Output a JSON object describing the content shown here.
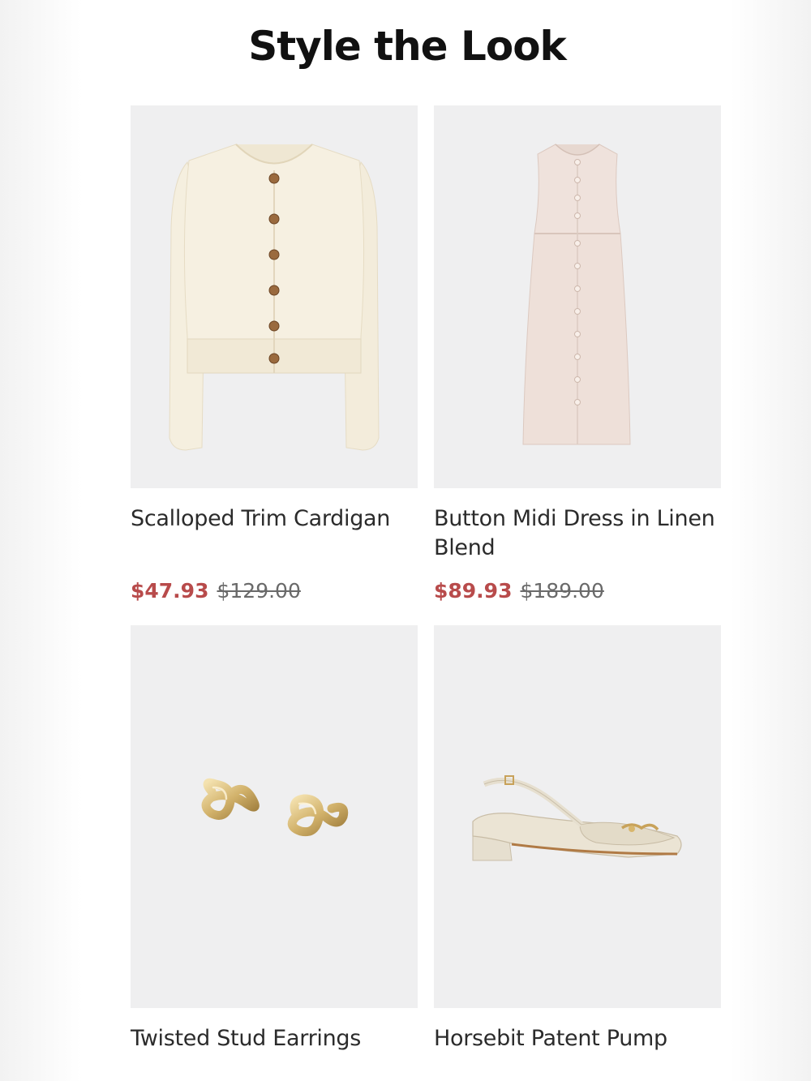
{
  "page": {
    "title": "Style the Look"
  },
  "products": [
    {
      "name": "Scalloped Trim Cardigan",
      "sale_price": "$47.93",
      "original_price": "$129.00",
      "image": "cardigan-image"
    },
    {
      "name": "Button Midi Dress in Linen Blend",
      "sale_price": "$89.93",
      "original_price": "$189.00",
      "image": "dress-image"
    },
    {
      "name": "Twisted Stud Earrings",
      "image": "earrings-image"
    },
    {
      "name": "Horsebit Patent Pump",
      "image": "pump-image"
    }
  ],
  "colors": {
    "sale_price": "#b84b4b",
    "original_price": "#6a6a6a",
    "image_background": "#efeff0"
  }
}
